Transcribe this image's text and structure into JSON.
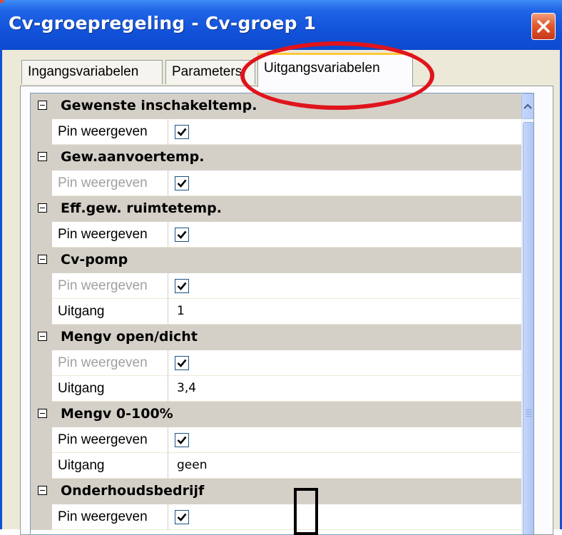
{
  "window": {
    "title": "Cv-groepregeling - Cv-groep 1",
    "close_icon": "close-x-icon"
  },
  "tabs": [
    {
      "label": "Ingangsvariabelen",
      "active": false
    },
    {
      "label": "Parameters",
      "active": false
    },
    {
      "label": "Uitgangsvariabelen",
      "active": true
    }
  ],
  "groups": [
    {
      "name": "Gewenste inschakeltemp.",
      "rows": [
        {
          "label": "Pin weergeven",
          "type": "checkbox",
          "checked": true,
          "disabled": false
        }
      ]
    },
    {
      "name": "Gew.aanvoertemp.",
      "rows": [
        {
          "label": "Pin weergeven",
          "type": "checkbox",
          "checked": true,
          "disabled": true
        }
      ]
    },
    {
      "name": "Eff.gew. ruimtetemp.",
      "rows": [
        {
          "label": "Pin weergeven",
          "type": "checkbox",
          "checked": true,
          "disabled": false
        }
      ]
    },
    {
      "name": "Cv-pomp",
      "rows": [
        {
          "label": "Pin weergeven",
          "type": "checkbox",
          "checked": true,
          "disabled": true
        },
        {
          "label": "Uitgang",
          "type": "text",
          "value": "1"
        }
      ]
    },
    {
      "name": "Mengv open/dicht",
      "rows": [
        {
          "label": "Pin weergeven",
          "type": "checkbox",
          "checked": true,
          "disabled": true
        },
        {
          "label": "Uitgang",
          "type": "text",
          "value": "3,4"
        }
      ]
    },
    {
      "name": "Mengv 0-100%",
      "rows": [
        {
          "label": "Pin weergeven",
          "type": "checkbox",
          "checked": true,
          "disabled": false
        },
        {
          "label": "Uitgang",
          "type": "text",
          "value": "geen"
        }
      ]
    },
    {
      "name": "Onderhoudsbedrijf",
      "rows": [
        {
          "label": "Pin weergeven",
          "type": "checkbox",
          "checked": true,
          "disabled": false
        }
      ]
    }
  ],
  "colors": {
    "titlebar": "#1151d8",
    "highlight_ring": "#e0141c",
    "category_bg": "#d4d0c8",
    "active_tab_accent": "#ffc83c"
  }
}
